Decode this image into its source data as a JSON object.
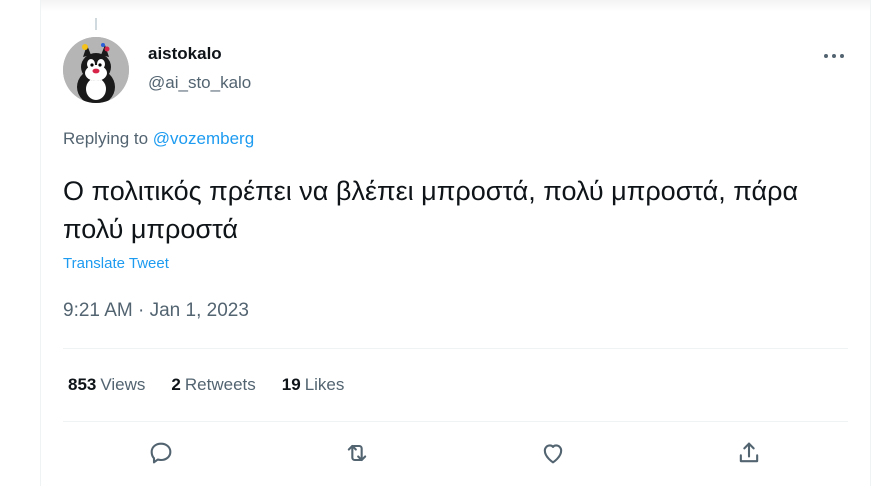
{
  "tweet": {
    "author_name": "aistokalo",
    "author_handle": "@ai_sto_kalo",
    "replying_prefix": "Replying to",
    "replying_to": "@vozemberg",
    "text": "Ο πολιτικός πρέπει να βλέπει μπροστά, πολύ μπροστά, πάρα πολύ μπροστά",
    "translate_label": "Translate Tweet",
    "timestamp": "9:21 AM · Jan 1, 2023"
  },
  "stats": [
    {
      "count": "853",
      "label": "Views"
    },
    {
      "count": "2",
      "label": "Retweets"
    },
    {
      "count": "19",
      "label": "Likes"
    }
  ],
  "actions": [
    {
      "name": "reply-icon"
    },
    {
      "name": "retweet-icon"
    },
    {
      "name": "like-icon"
    },
    {
      "name": "share-icon"
    }
  ],
  "colors": {
    "accent": "#1d9bf0",
    "secondary_text": "#536471",
    "primary_text": "#0f1419",
    "divider": "#eff3f4"
  }
}
